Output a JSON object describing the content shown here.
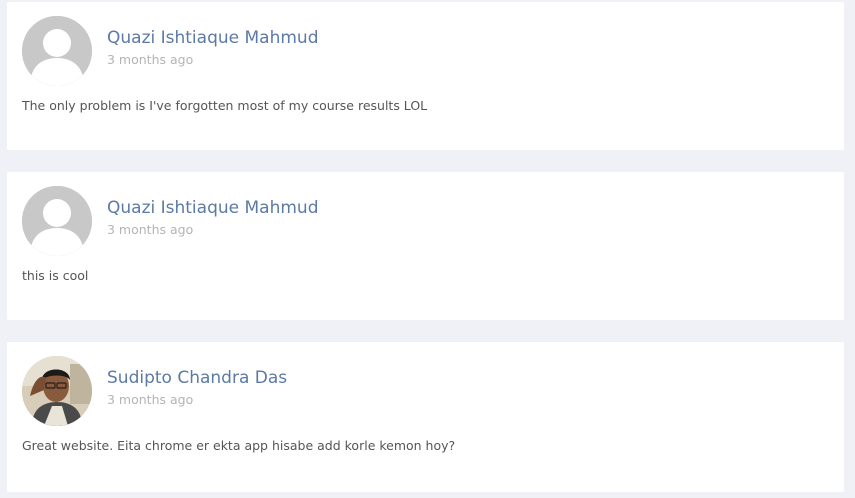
{
  "comments": [
    {
      "author": "Quazi Ishtiaque Mahmud",
      "time": "3 months ago",
      "text": "The only problem is I've forgotten most of my course results LOL",
      "avatar": "default-user-icon"
    },
    {
      "author": "Quazi Ishtiaque Mahmud",
      "time": "3 months ago",
      "text": "this is cool",
      "avatar": "default-user-icon"
    },
    {
      "author": "Sudipto Chandra Das",
      "time": "3 months ago",
      "text": "Great website. Eita chrome er ekta app hisabe add korle kemon hoy?",
      "avatar": "user-photo"
    }
  ],
  "colors": {
    "background": "#f0f1f6",
    "card": "#ffffff",
    "author": "#5b7aa6",
    "timestamp": "#b4b4b4",
    "text": "#555555",
    "avatar_placeholder": "#c8c8c8"
  }
}
